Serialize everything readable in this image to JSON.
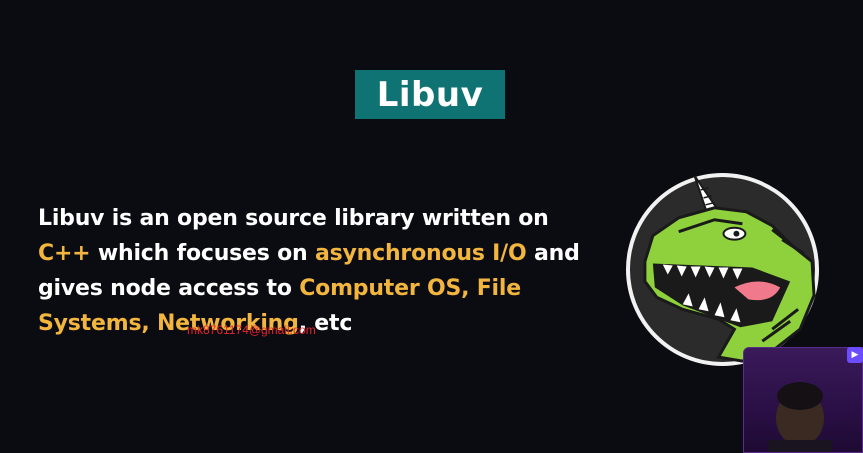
{
  "slide": {
    "title": "Libuv",
    "body": {
      "p1": "Libuv is an open source library written on ",
      "h1": "C++",
      "p2": " which focuses on ",
      "h2": "asynchronous I/O",
      "p3": " and gives node access to ",
      "h3": "Computer OS, File Systems, Networking",
      "p4": ", etc"
    },
    "watermark": "mk8761174@gmail.com"
  },
  "icons": {
    "logo": "libuv-unicorn-dinosaur-logo",
    "webcam": "presenter-webcam",
    "play": "play-icon"
  },
  "colors": {
    "background": "#0b0b12",
    "title_box": "#0f7373",
    "highlight": "#f2b53d",
    "watermark": "#e5252a",
    "dino_green": "#8ed13c"
  }
}
